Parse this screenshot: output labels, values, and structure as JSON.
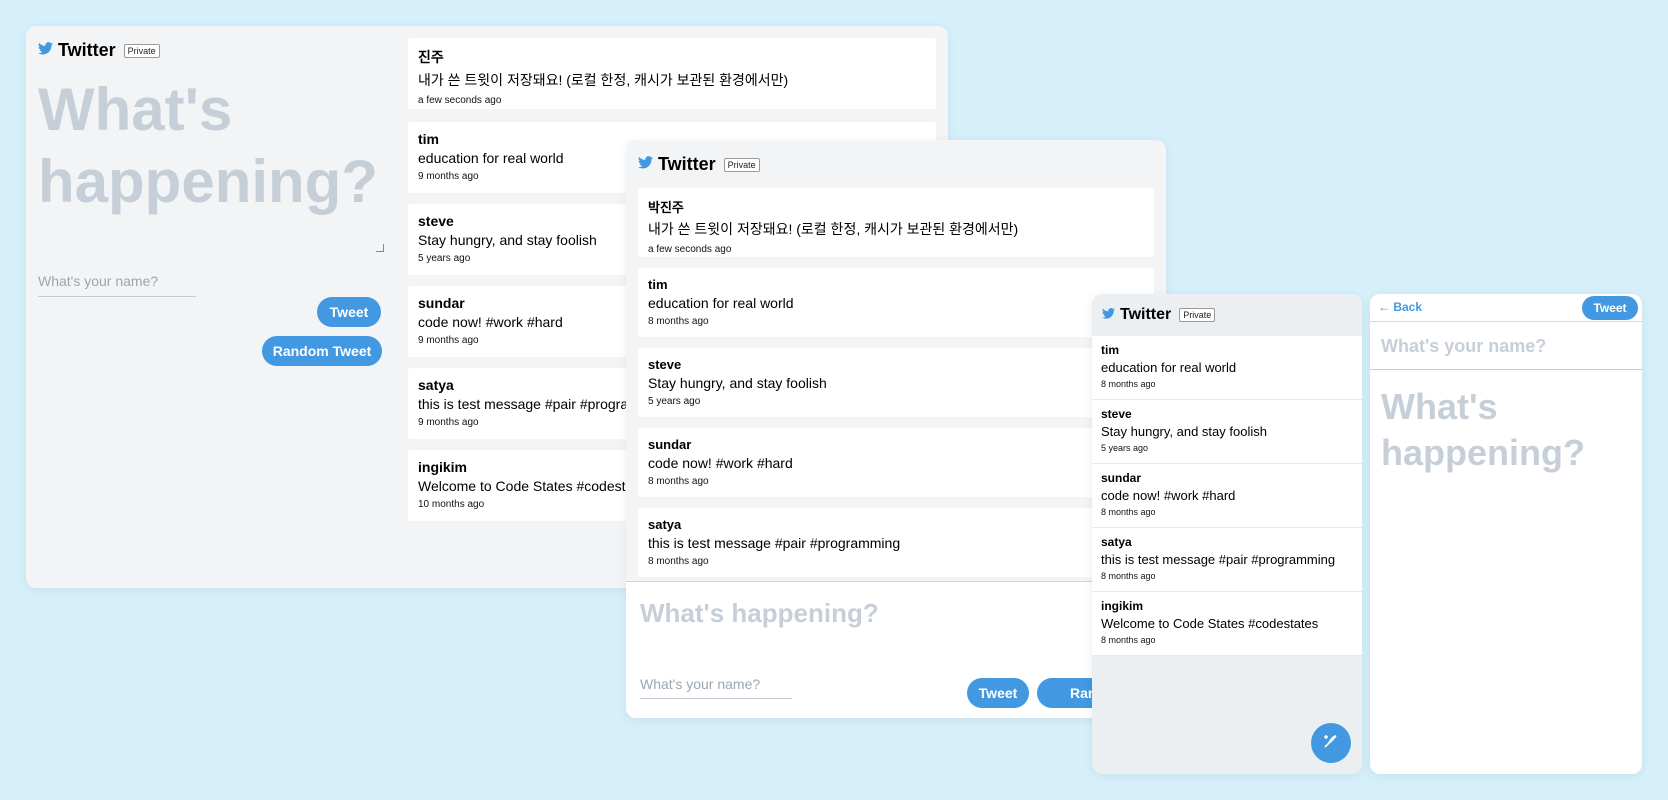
{
  "colors": {
    "accent": "#4299e1",
    "background": "#d6f0fb"
  },
  "panelA": {
    "brand": {
      "name": "Twitter",
      "badge": "Private",
      "icon": "twitter-bird-icon"
    },
    "compose": {
      "text_placeholder": "What's happening?",
      "name_placeholder": "What's your name?",
      "tweet_label": "Tweet",
      "random_label": "Random Tweet"
    },
    "tweets": [
      {
        "name": "진주",
        "message": "내가 쓴 트윗이 저장돼요! (로컬 한정, 캐시가 보관된 환경에서만)",
        "time": "a few seconds ago"
      },
      {
        "name": "tim",
        "message": "education for real world",
        "time": "9 months ago"
      },
      {
        "name": "steve",
        "message": "Stay hungry, and stay foolish",
        "time": "5 years ago"
      },
      {
        "name": "sundar",
        "message": "code now! #work #hard",
        "time": "9 months ago"
      },
      {
        "name": "satya",
        "message": "this is test message #pair #programming",
        "time": "9 months ago"
      },
      {
        "name": "ingikim",
        "message": "Welcome to Code States #codestates",
        "time": "10 months ago"
      }
    ]
  },
  "panelB": {
    "brand": {
      "name": "Twitter",
      "badge": "Private",
      "icon": "twitter-bird-icon"
    },
    "tweets": [
      {
        "name": "박진주",
        "message": "내가 쓴 트윗이 저장돼요! (로컬 한정, 캐시가 보관된 환경에서만)",
        "time": "a few seconds ago"
      },
      {
        "name": "tim",
        "message": "education for real world",
        "time": "8 months ago"
      },
      {
        "name": "steve",
        "message": "Stay hungry, and stay foolish",
        "time": "5 years ago"
      },
      {
        "name": "sundar",
        "message": "code now! #work #hard",
        "time": "8 months ago"
      },
      {
        "name": "satya",
        "message": "this is test message #pair #programming",
        "time": "8 months ago"
      }
    ],
    "compose": {
      "text_placeholder": "What's happening?",
      "name_placeholder": "What's your name?",
      "tweet_label": "Tweet",
      "random_label": "Random"
    }
  },
  "panelC": {
    "brand": {
      "name": "Twitter",
      "badge": "Private",
      "icon": "twitter-bird-icon"
    },
    "tweets": [
      {
        "name": "tim",
        "message": "education for real world",
        "time": "8 months ago"
      },
      {
        "name": "steve",
        "message": "Stay hungry, and stay foolish",
        "time": "5 years ago"
      },
      {
        "name": "sundar",
        "message": "code now! #work #hard",
        "time": "8 months ago"
      },
      {
        "name": "satya",
        "message": "this is test message #pair #programming",
        "time": "8 months ago"
      },
      {
        "name": "ingikim",
        "message": "Welcome to Code States #codestates",
        "time": "8 months ago"
      }
    ],
    "fab_icon": "compose-feather-icon"
  },
  "panelD": {
    "back_label": "← Back",
    "tweet_label": "Tweet",
    "name_placeholder": "What's your name?",
    "text_placeholder": "What's happening?"
  }
}
